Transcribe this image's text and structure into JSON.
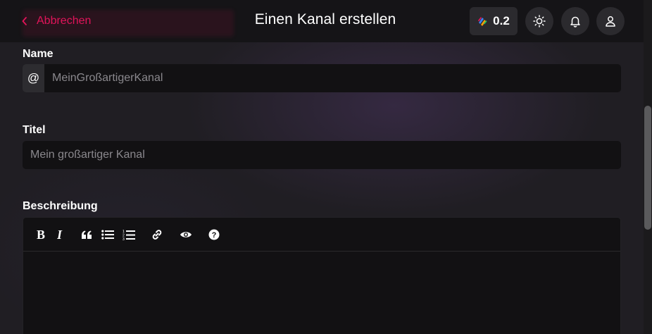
{
  "header": {
    "cancel_label": "Abbrechen",
    "title": "Einen Kanal erstellen",
    "points": "0.2",
    "icons": [
      "sun-icon",
      "bell-icon",
      "user-icon"
    ]
  },
  "form": {
    "name": {
      "label": "Name",
      "prefix": "@",
      "placeholder": "MeinGroßartigerKanal"
    },
    "title": {
      "label": "Titel",
      "placeholder": "Mein großartiger Kanal"
    },
    "description": {
      "label": "Beschreibung",
      "toolbar": [
        "bold",
        "italic",
        "quote",
        "bullet-list",
        "numbered-list",
        "link",
        "preview",
        "help"
      ]
    }
  },
  "colors": {
    "accent": "#e2145a",
    "background": "#201e23",
    "field": "#121113"
  }
}
